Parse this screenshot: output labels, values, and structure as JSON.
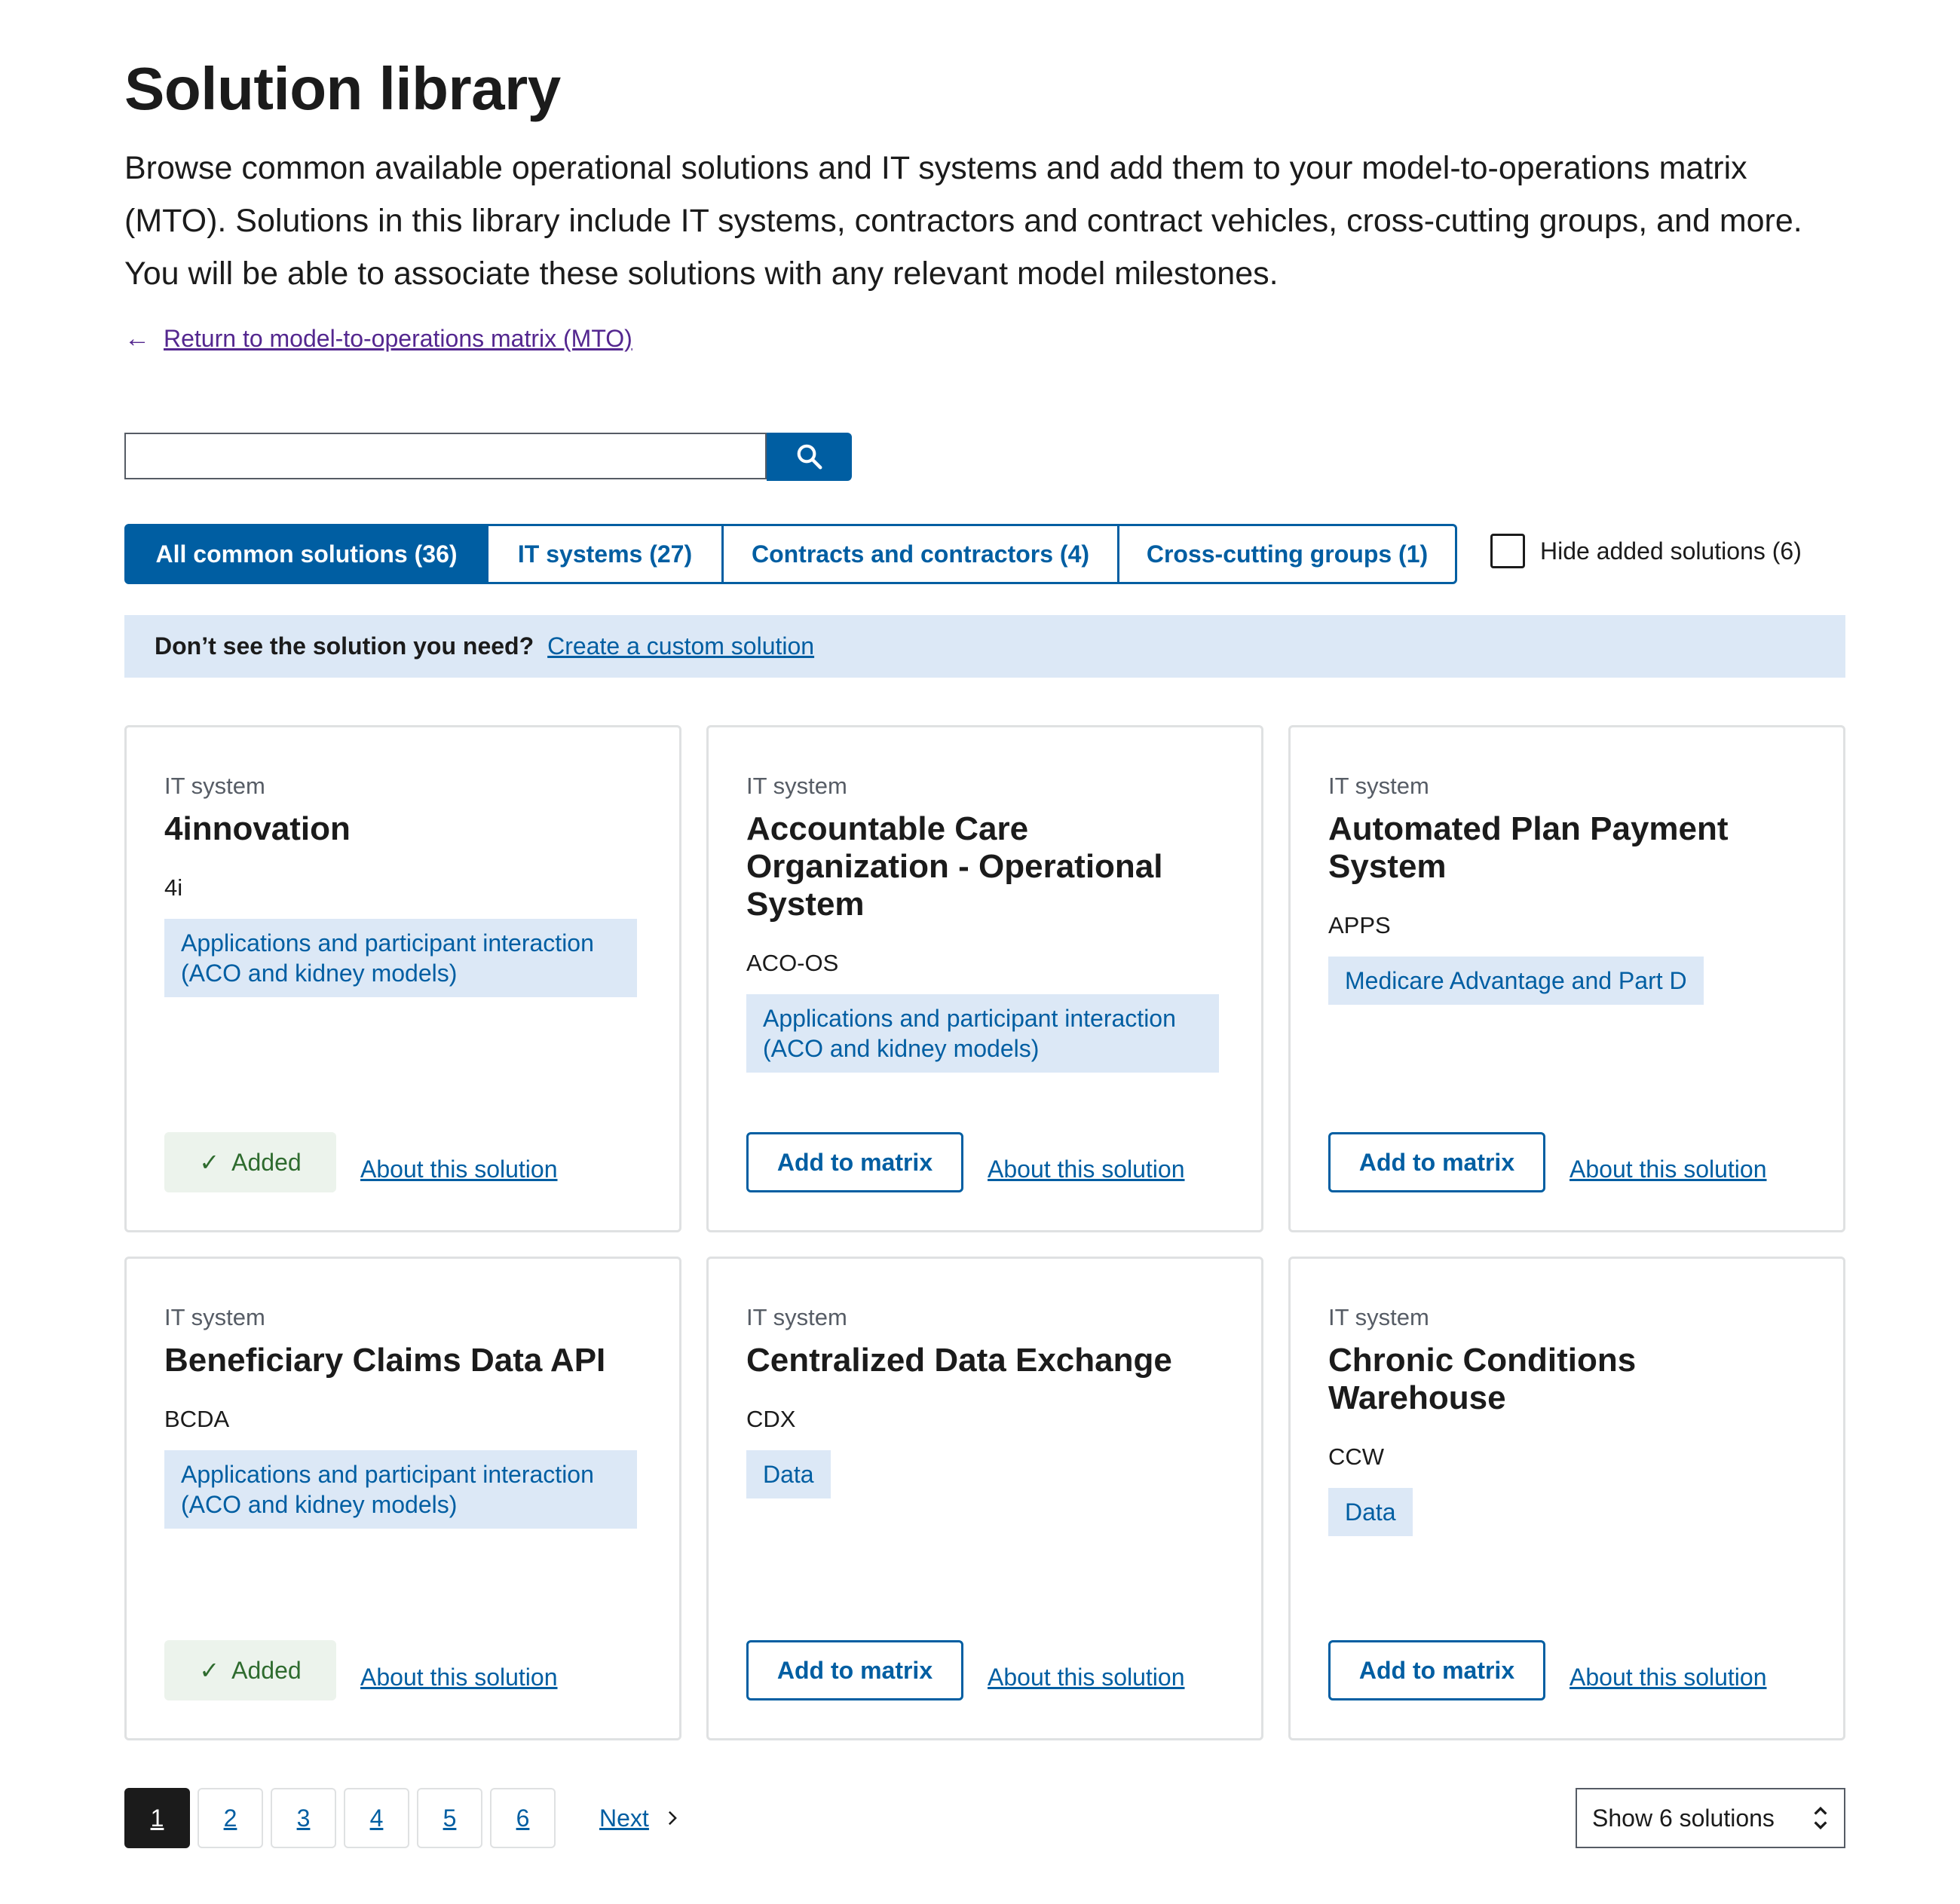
{
  "page": {
    "title": "Solution library",
    "intro": "Browse common available operational solutions and IT systems and add them to your model-to-operations matrix (MTO). Solutions in this library include IT systems, contractors and contract vehicles, cross-cutting groups, and more. You will be able to associate these solutions with any relevant model milestones.",
    "back_link": "Return to model-to-operations matrix (MTO)"
  },
  "search": {
    "value": "",
    "placeholder": ""
  },
  "tabs": [
    {
      "label": "All common solutions (36)",
      "active": true
    },
    {
      "label": "IT systems (27)",
      "active": false
    },
    {
      "label": "Contracts and contractors (4)",
      "active": false
    },
    {
      "label": "Cross-cutting groups (1)",
      "active": false
    }
  ],
  "hide_added": {
    "label": "Hide added solutions (6)",
    "checked": false
  },
  "banner": {
    "question": "Don’t see the solution you need?",
    "link": "Create a custom solution"
  },
  "cards": [
    {
      "kind": "IT system",
      "name": "4innovation",
      "acronym": "4i",
      "tag": "Applications and participant interaction (ACO and kidney models)",
      "status": "Added",
      "about": "About this solution"
    },
    {
      "kind": "IT system",
      "name": "Accountable Care Organization - Operational System",
      "acronym": "ACO-OS",
      "tag": "Applications and participant interaction (ACO and kidney models)",
      "status": "Add to matrix",
      "about": "About this solution"
    },
    {
      "kind": "IT system",
      "name": "Automated Plan Payment System",
      "acronym": "APPS",
      "tag": "Medicare Advantage and Part D",
      "status": "Add to matrix",
      "about": "About this solution"
    },
    {
      "kind": "IT system",
      "name": "Beneficiary Claims Data API",
      "acronym": "BCDA",
      "tag": "Applications and participant interaction (ACO and kidney models)",
      "status": "Added",
      "about": "About this solution"
    },
    {
      "kind": "IT system",
      "name": "Centralized Data Exchange",
      "acronym": "CDX",
      "tag": "Data",
      "status": "Add to matrix",
      "about": "About this solution"
    },
    {
      "kind": "IT system",
      "name": "Chronic Conditions Warehouse",
      "acronym": "CCW",
      "tag": "Data",
      "status": "Add to matrix",
      "about": "About this solution"
    }
  ],
  "pagination": {
    "pages": [
      "1",
      "2",
      "3",
      "4",
      "5",
      "6"
    ],
    "current": "1",
    "next": "Next"
  },
  "page_size": {
    "selected": "Show 6 solutions"
  },
  "colors": {
    "primary": "#005ea2",
    "visited_link": "#54278f",
    "tag_bg": "#dce8f6",
    "added_bg": "#ecf3ec",
    "added_text": "#2e6b2e"
  },
  "icons": {
    "search": "search-icon",
    "back": "arrow-left-icon",
    "check": "check-icon",
    "next": "chevron-right-icon",
    "select": "unfold-icon"
  }
}
